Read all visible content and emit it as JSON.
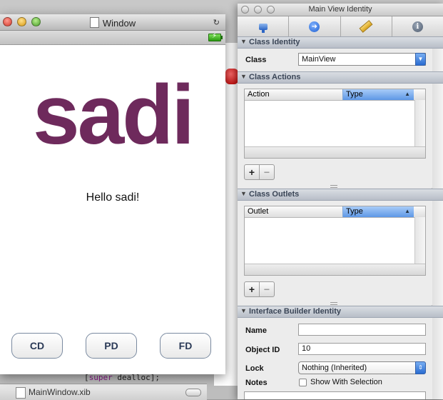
{
  "background": {
    "xib_window_title": "MainWindow.xib",
    "code_keyword": "super",
    "code_rest": " dealloc];",
    "code_open": "["
  },
  "app_window": {
    "title": "Window",
    "logo_text": "sadi",
    "logo_color": "#6e2a5c",
    "hello_text": "Hello sadi!",
    "buttons": {
      "cd": "CD",
      "pd": "PD",
      "fd": "FD"
    }
  },
  "inspector": {
    "title": "Main View Identity",
    "class_identity": {
      "header": "Class Identity",
      "class_label": "Class",
      "class_value": "MainView"
    },
    "class_actions": {
      "header": "Class Actions",
      "col_action": "Action",
      "col_type": "Type",
      "add": "+",
      "remove": "−"
    },
    "class_outlets": {
      "header": "Class Outlets",
      "col_outlet": "Outlet",
      "col_type": "Type",
      "add": "+",
      "remove": "−"
    },
    "ib_identity": {
      "header": "Interface Builder Identity",
      "name_label": "Name",
      "name_value": "",
      "object_id_label": "Object ID",
      "object_id_value": "10",
      "lock_label": "Lock",
      "lock_value": "Nothing (Inherited)",
      "notes_label": "Notes",
      "show_with_selection": "Show With Selection"
    }
  }
}
